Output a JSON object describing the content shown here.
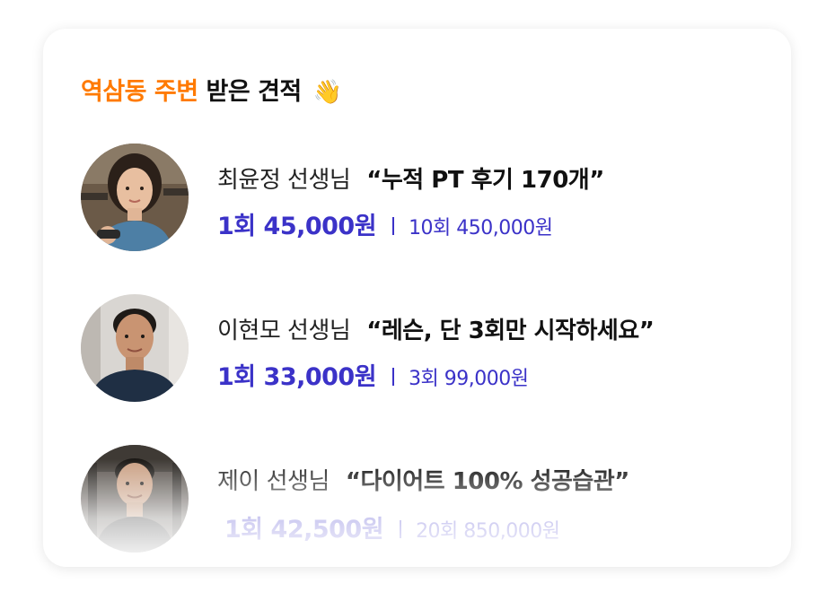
{
  "header": {
    "title_accent": "역삼동 주변",
    "title_rest": " 받은 견적",
    "emoji": "👋"
  },
  "quotes": [
    {
      "teacher": "최윤정 선생님",
      "tagline": "“누적 PT 후기 170개”",
      "price_main": "1회 45,000원",
      "price_sub": "10회 450,000원"
    },
    {
      "teacher": "이현모 선생님",
      "tagline": "“레슨, 단 3회만 시작하세요”",
      "price_main": "1회 33,000원",
      "price_sub": "3회 99,000원"
    },
    {
      "teacher": "제이 선생님",
      "tagline": "“다이어트 100% 성공습관”",
      "price_main": "1회 42,500원",
      "price_sub": "20회 850,000원"
    }
  ],
  "colors": {
    "accent_orange": "#ff7a00",
    "price_blue": "#3b32c8"
  }
}
